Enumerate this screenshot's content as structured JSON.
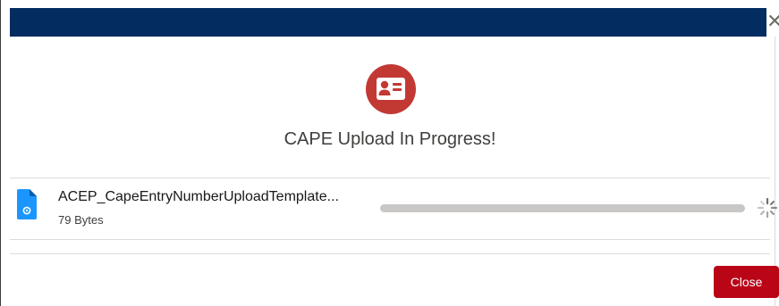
{
  "modal": {
    "close_icon": "close-icon",
    "hero_icon": "contact-card-icon",
    "title": "CAPE Upload In Progress!"
  },
  "file": {
    "name": "ACEP_CapeEntryNumberUploadTemplate...",
    "size": "79 Bytes",
    "icon": "file-icon",
    "progress": 0,
    "status_icon": "spinner-icon"
  },
  "footer": {
    "close_label": "Close"
  },
  "colors": {
    "header": "#032d60",
    "accent_red": "#c23934",
    "button_red": "#ba0517",
    "file_icon_blue": "#1b96ff",
    "progress_track": "#c9c7c5"
  }
}
